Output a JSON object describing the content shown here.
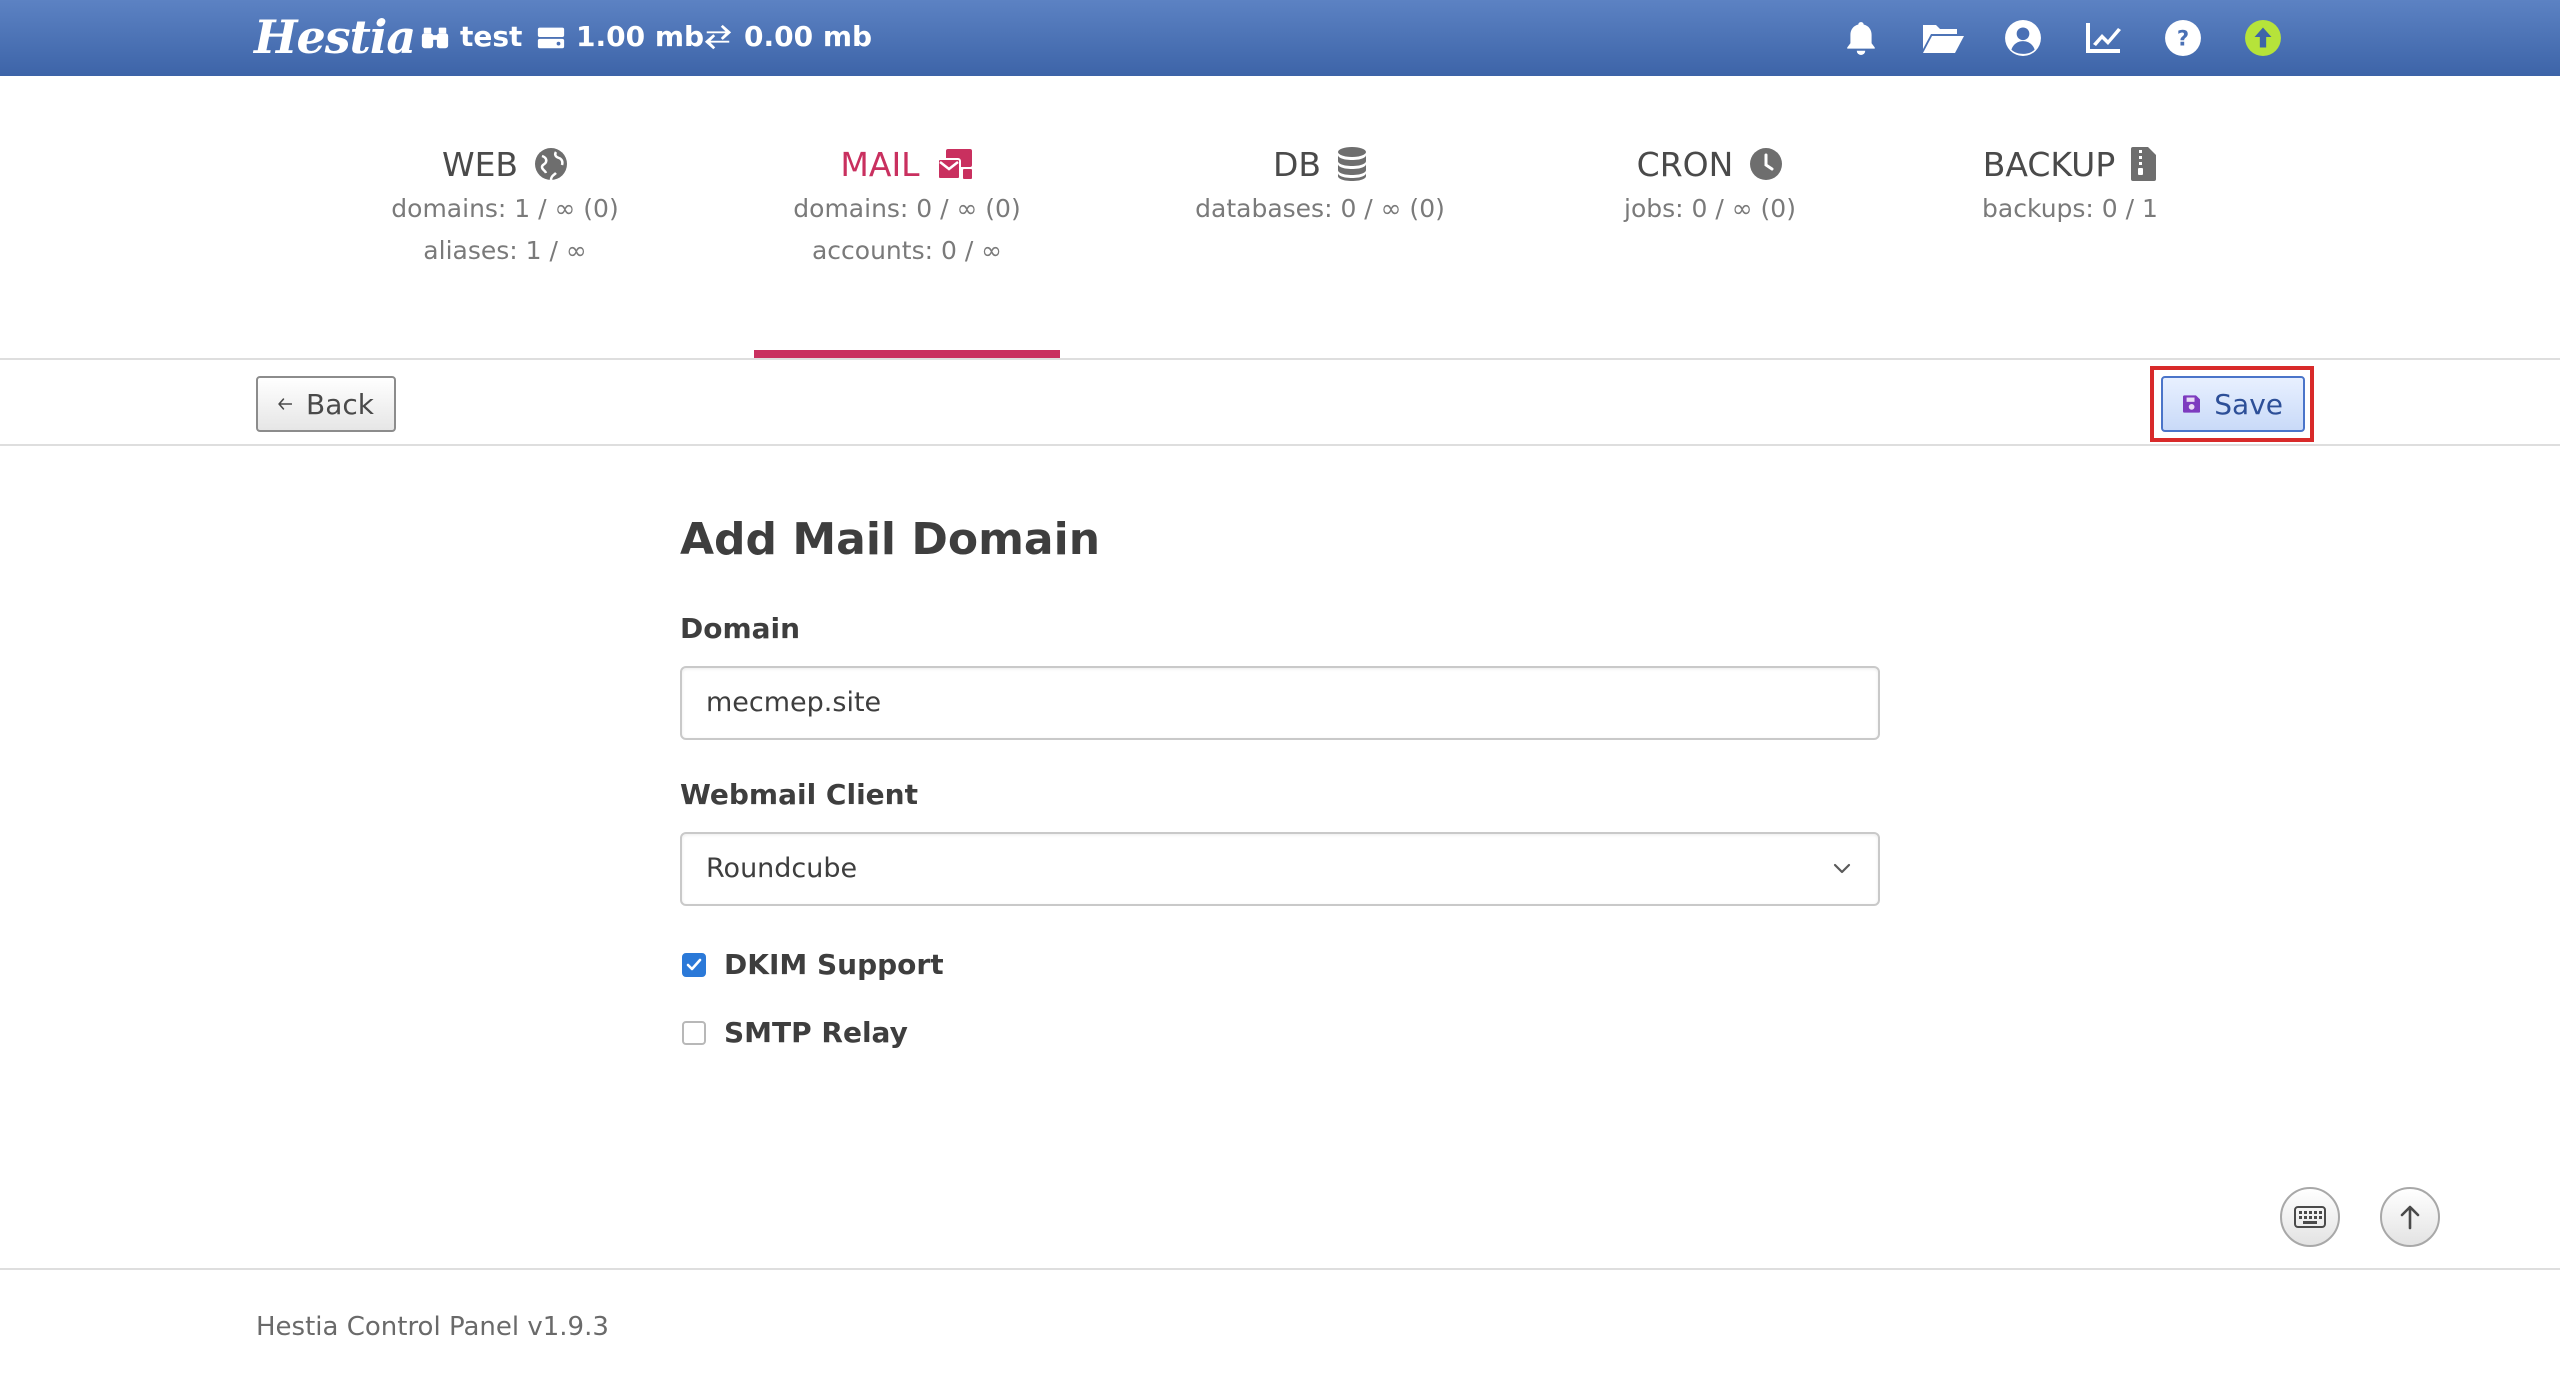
{
  "topbar": {
    "logo": "Hestia",
    "user": "test",
    "disk": "1.00 mb",
    "bandwidth": "0.00 mb",
    "icons": [
      "bell-icon",
      "folder-open-icon",
      "user-circle-icon",
      "chart-line-icon",
      "question-circle-icon",
      "arrow-up-circle-icon"
    ],
    "update_color": "#b6e33a"
  },
  "tabs": [
    {
      "title": "WEB",
      "icon": "globe-icon",
      "line1": "domains: 1 / ∞ (0)",
      "line2": "aliases: 1 / ∞"
    },
    {
      "title": "MAIL",
      "icon": "mail-bulk-icon",
      "line1": "domains: 0 / ∞ (0)",
      "line2": "accounts: 0 / ∞",
      "active": true
    },
    {
      "title": "DB",
      "icon": "database-icon",
      "line1": "databases: 0 / ∞ (0)",
      "line2": ""
    },
    {
      "title": "CRON",
      "icon": "clock-icon",
      "line1": "jobs: 0 / ∞ (0)",
      "line2": ""
    },
    {
      "title": "BACKUP",
      "icon": "file-archive-icon",
      "line1": "backups: 0 / 1",
      "line2": ""
    }
  ],
  "toolbar": {
    "back_label": "Back",
    "save_label": "Save"
  },
  "form": {
    "title": "Add Mail Domain",
    "domain_label": "Domain",
    "domain_value": "mecmep.site",
    "webmail_label": "Webmail Client",
    "webmail_value": "Roundcube",
    "dkim_label": "DKIM Support",
    "dkim_checked": true,
    "smtp_label": "SMTP Relay",
    "smtp_checked": false
  },
  "footer": {
    "text": "Hestia Control Panel v1.9.3"
  },
  "colors": {
    "accent": "#c9305f",
    "topbar": "#4a70b5",
    "checkbox": "#2b79d8",
    "highlight": "#d82a2a"
  }
}
